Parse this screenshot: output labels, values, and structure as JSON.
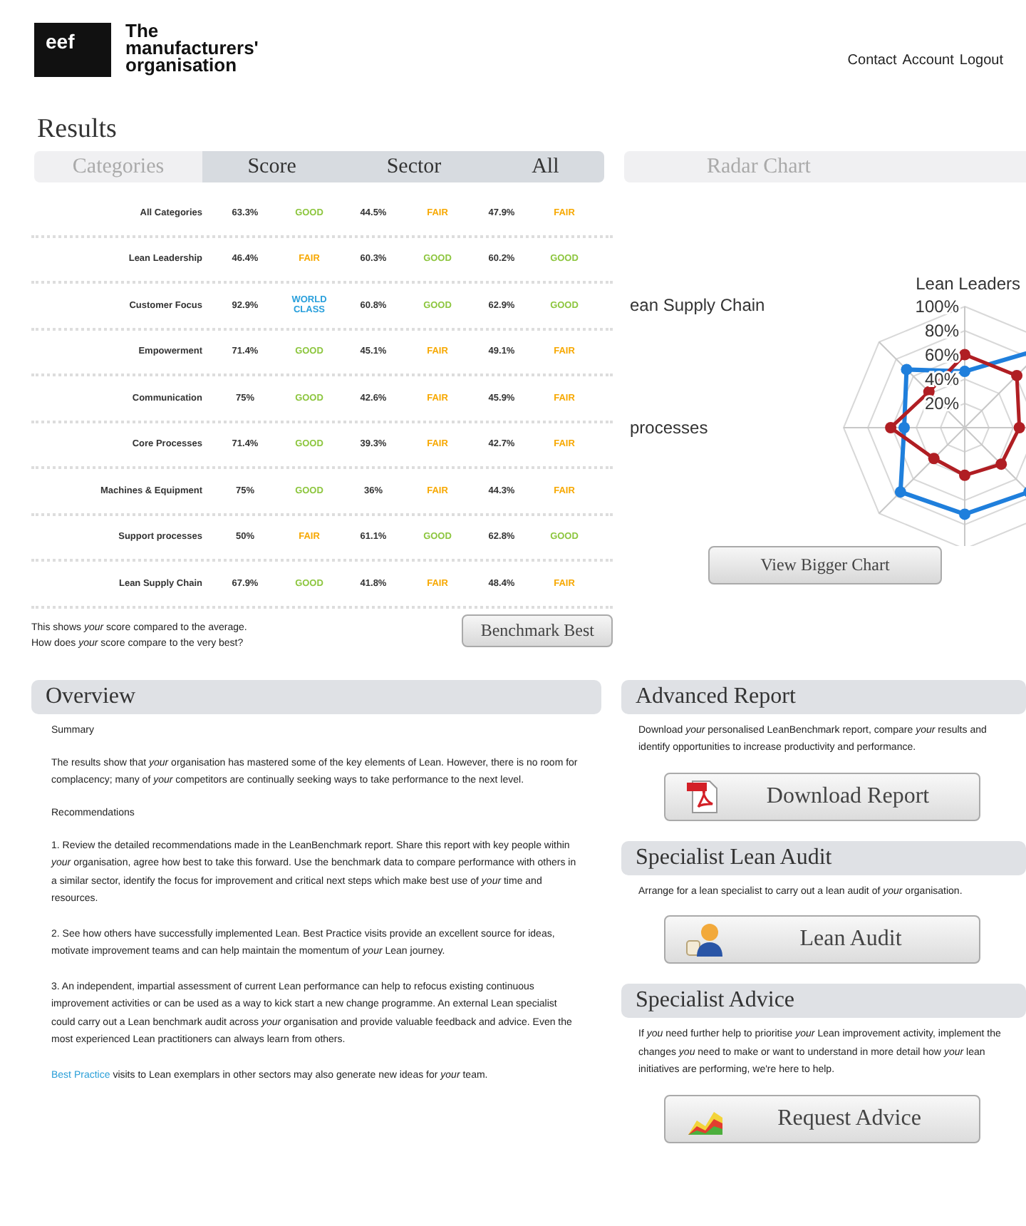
{
  "logo": {
    "mark": "eef",
    "name_line_1": "The",
    "name_line_2": "manufacturers'",
    "name_line_3": "organisation"
  },
  "nav": [
    "Contact",
    "Account",
    "Logout"
  ],
  "page_title": "Results",
  "header_cells": [
    {
      "kind": "label",
      "label": "Categories"
    },
    {
      "kind": "column",
      "label": "Score"
    },
    {
      "kind": "column",
      "label": "Sector"
    },
    {
      "kind": "column",
      "label": "All"
    },
    {
      "kind": "label",
      "label": "Radar Chart"
    }
  ],
  "rows": [
    {
      "category": "All Categories",
      "score": "63.3%",
      "score_rating": {
        "kind": "good",
        "text": "GOOD"
      },
      "sector": "44.5%",
      "sector_rating": {
        "kind": "fair",
        "text": "FAIR"
      },
      "all": "47.9%",
      "all_rating": {
        "kind": "fair",
        "text": "FAIR"
      }
    },
    {
      "category": "Lean Leadership",
      "score": "46.4%",
      "score_rating": {
        "kind": "fair",
        "text": "FAIR"
      },
      "sector": "60.3%",
      "sector_rating": {
        "kind": "good",
        "text": "GOOD"
      },
      "all": "60.2%",
      "all_rating": {
        "kind": "good",
        "text": "GOOD"
      }
    },
    {
      "category": "Customer Focus",
      "score": "92.9%",
      "score_rating": {
        "kind": "world_class",
        "text": "WORLD CLASS"
      },
      "sector": "60.8%",
      "sector_rating": {
        "kind": "good",
        "text": "GOOD"
      },
      "all": "62.9%",
      "all_rating": {
        "kind": "good",
        "text": "GOOD"
      }
    },
    {
      "category": "Empowerment",
      "score": "71.4%",
      "score_rating": {
        "kind": "good",
        "text": "GOOD"
      },
      "sector": "45.1%",
      "sector_rating": {
        "kind": "fair",
        "text": "FAIR"
      },
      "all": "49.1%",
      "all_rating": {
        "kind": "fair",
        "text": "FAIR"
      }
    },
    {
      "category": "Communication",
      "score": "75%",
      "score_rating": {
        "kind": "good",
        "text": "GOOD"
      },
      "sector": "42.6%",
      "sector_rating": {
        "kind": "fair",
        "text": "FAIR"
      },
      "all": "45.9%",
      "all_rating": {
        "kind": "fair",
        "text": "FAIR"
      }
    },
    {
      "category": "Core Processes",
      "score": "71.4%",
      "score_rating": {
        "kind": "good",
        "text": "GOOD"
      },
      "sector": "39.3%",
      "sector_rating": {
        "kind": "fair",
        "text": "FAIR"
      },
      "all": "42.7%",
      "all_rating": {
        "kind": "fair",
        "text": "FAIR"
      }
    },
    {
      "category": "Machines & Equipment",
      "score": "75%",
      "score_rating": {
        "kind": "good",
        "text": "GOOD"
      },
      "sector": "36%",
      "sector_rating": {
        "kind": "fair",
        "text": "FAIR"
      },
      "all": "44.3%",
      "all_rating": {
        "kind": "fair",
        "text": "FAIR"
      }
    },
    {
      "category": "Support processes",
      "score": "50%",
      "score_rating": {
        "kind": "fair",
        "text": "FAIR"
      },
      "sector": "61.1%",
      "sector_rating": {
        "kind": "good",
        "text": "GOOD"
      },
      "all": "62.8%",
      "all_rating": {
        "kind": "good",
        "text": "GOOD"
      }
    },
    {
      "category": "Lean Supply Chain",
      "score": "67.9%",
      "score_rating": {
        "kind": "good",
        "text": "GOOD"
      },
      "sector": "41.8%",
      "sector_rating": {
        "kind": "fair",
        "text": "FAIR"
      },
      "all": "48.4%",
      "all_rating": {
        "kind": "fair",
        "text": "FAIR"
      }
    }
  ],
  "table_note": "This shows *your* score compared to the average.\nHow does *your* score compare to the very best?",
  "benchmark_button": "Benchmark Best",
  "radar": {
    "axis_labels": [
      {
        "kind": "top",
        "text": "Lean Leaders"
      },
      {
        "kind": "upper_left",
        "text": "ean Supply Chain"
      },
      {
        "kind": "left",
        "text": "processes"
      }
    ],
    "ticks": [
      "100%",
      "80%",
      "60%",
      "40%",
      "20%"
    ]
  },
  "chart_button": "View Bigger Chart",
  "overview": {
    "title": "Overview",
    "blocks": [
      {
        "kind": "heading",
        "text": "Summary"
      },
      {
        "kind": "paragraph",
        "text": "The results show that *your* organisation has mastered some of the key elements of Lean. However, there is no room for complacency; many of *your* competitors are continually seeking ways to take performance to the next level."
      },
      {
        "kind": "heading",
        "text": "Recommendations"
      },
      {
        "kind": "paragraph",
        "text": "1. Review the detailed recommendations made in the LeanBenchmark report. Share this report with key people within *your* organisation, agree how best to take this forward. Use the benchmark data to compare performance with others in a similar sector, identify the focus for improvement and critical next steps which make best use of *your* time and resources."
      },
      {
        "kind": "paragraph",
        "text": "2. See how others have successfully implemented Lean. Best Practice visits provide an excellent source for ideas, motivate improvement teams and can help maintain the momentum of *your* Lean journey."
      },
      {
        "kind": "paragraph",
        "text": "3. An independent, impartial assessment of current Lean performance can help to refocus existing continuous improvement activities or can be used as a way to kick start a new change programme. An external Lean specialist could carry out a Lean benchmark audit across *your* organisation and provide valuable feedback and advice. Even the most experienced Lean practitioners can always learn from others."
      },
      {
        "kind": "link_paragraph",
        "link": "Best Practice",
        "text": " visits to Lean exemplars in other sectors may also generate new ideas for *your* team."
      }
    ]
  },
  "panels": [
    {
      "title": "Advanced Report",
      "text": "Download *your* personalised LeanBenchmark report, compare *your* results and identify opportunities to increase productivity and performance.",
      "button": {
        "kind": "pdf",
        "label": "Download Report"
      }
    },
    {
      "title": "Specialist Lean Audit",
      "text": "Arrange for a lean specialist to carry out a lean audit of *your* organisation.",
      "button": {
        "kind": "person",
        "label": "Lean Audit"
      }
    },
    {
      "title": "Specialist Advice",
      "text": "If *you* need further help to prioritise *your* Lean improvement activity, implement the changes *you* need to make or want to understand in more detail how *your* lean initiatives are performing, we're here to help.",
      "button": {
        "kind": "chart",
        "label": "Request Advice"
      }
    }
  ]
}
